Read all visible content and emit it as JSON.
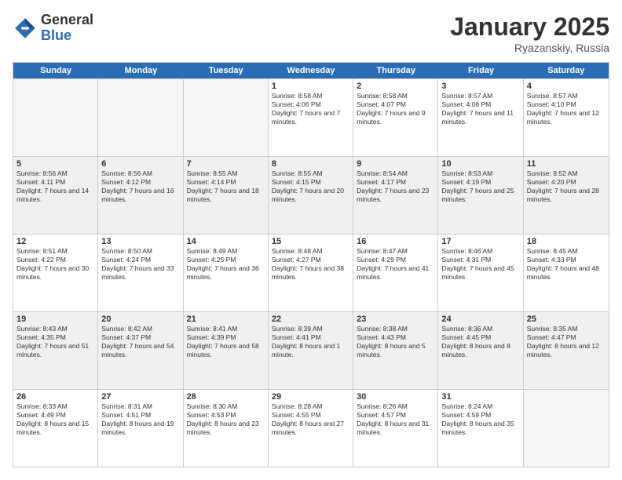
{
  "logo": {
    "general": "General",
    "blue": "Blue"
  },
  "title": "January 2025",
  "location": "Ryazanskiy, Russia",
  "days": [
    "Sunday",
    "Monday",
    "Tuesday",
    "Wednesday",
    "Thursday",
    "Friday",
    "Saturday"
  ],
  "weeks": [
    [
      {
        "day": "",
        "empty": true
      },
      {
        "day": "",
        "empty": true
      },
      {
        "day": "",
        "empty": true
      },
      {
        "day": "1",
        "sunrise": "8:58 AM",
        "sunset": "4:06 PM",
        "daylight": "7 hours and 7 minutes."
      },
      {
        "day": "2",
        "sunrise": "8:58 AM",
        "sunset": "4:07 PM",
        "daylight": "7 hours and 9 minutes."
      },
      {
        "day": "3",
        "sunrise": "8:57 AM",
        "sunset": "4:08 PM",
        "daylight": "7 hours and 11 minutes."
      },
      {
        "day": "4",
        "sunrise": "8:57 AM",
        "sunset": "4:10 PM",
        "daylight": "7 hours and 12 minutes."
      }
    ],
    [
      {
        "day": "5",
        "sunrise": "8:56 AM",
        "sunset": "4:11 PM",
        "daylight": "7 hours and 14 minutes."
      },
      {
        "day": "6",
        "sunrise": "8:56 AM",
        "sunset": "4:12 PM",
        "daylight": "7 hours and 16 minutes."
      },
      {
        "day": "7",
        "sunrise": "8:55 AM",
        "sunset": "4:14 PM",
        "daylight": "7 hours and 18 minutes."
      },
      {
        "day": "8",
        "sunrise": "8:55 AM",
        "sunset": "4:15 PM",
        "daylight": "7 hours and 20 minutes."
      },
      {
        "day": "9",
        "sunrise": "8:54 AM",
        "sunset": "4:17 PM",
        "daylight": "7 hours and 23 minutes."
      },
      {
        "day": "10",
        "sunrise": "8:53 AM",
        "sunset": "4:19 PM",
        "daylight": "7 hours and 25 minutes."
      },
      {
        "day": "11",
        "sunrise": "8:52 AM",
        "sunset": "4:20 PM",
        "daylight": "7 hours and 28 minutes."
      }
    ],
    [
      {
        "day": "12",
        "sunrise": "8:51 AM",
        "sunset": "4:22 PM",
        "daylight": "7 hours and 30 minutes."
      },
      {
        "day": "13",
        "sunrise": "8:50 AM",
        "sunset": "4:24 PM",
        "daylight": "7 hours and 33 minutes."
      },
      {
        "day": "14",
        "sunrise": "8:49 AM",
        "sunset": "4:25 PM",
        "daylight": "7 hours and 36 minutes."
      },
      {
        "day": "15",
        "sunrise": "8:48 AM",
        "sunset": "4:27 PM",
        "daylight": "7 hours and 38 minutes."
      },
      {
        "day": "16",
        "sunrise": "8:47 AM",
        "sunset": "4:29 PM",
        "daylight": "7 hours and 41 minutes."
      },
      {
        "day": "17",
        "sunrise": "8:46 AM",
        "sunset": "4:31 PM",
        "daylight": "7 hours and 45 minutes."
      },
      {
        "day": "18",
        "sunrise": "8:45 AM",
        "sunset": "4:33 PM",
        "daylight": "7 hours and 48 minutes."
      }
    ],
    [
      {
        "day": "19",
        "sunrise": "8:43 AM",
        "sunset": "4:35 PM",
        "daylight": "7 hours and 51 minutes."
      },
      {
        "day": "20",
        "sunrise": "8:42 AM",
        "sunset": "4:37 PM",
        "daylight": "7 hours and 54 minutes."
      },
      {
        "day": "21",
        "sunrise": "8:41 AM",
        "sunset": "4:39 PM",
        "daylight": "7 hours and 58 minutes."
      },
      {
        "day": "22",
        "sunrise": "8:39 AM",
        "sunset": "4:41 PM",
        "daylight": "8 hours and 1 minute."
      },
      {
        "day": "23",
        "sunrise": "8:38 AM",
        "sunset": "4:43 PM",
        "daylight": "8 hours and 5 minutes."
      },
      {
        "day": "24",
        "sunrise": "8:36 AM",
        "sunset": "4:45 PM",
        "daylight": "8 hours and 8 minutes."
      },
      {
        "day": "25",
        "sunrise": "8:35 AM",
        "sunset": "4:47 PM",
        "daylight": "8 hours and 12 minutes."
      }
    ],
    [
      {
        "day": "26",
        "sunrise": "8:33 AM",
        "sunset": "4:49 PM",
        "daylight": "8 hours and 15 minutes."
      },
      {
        "day": "27",
        "sunrise": "8:31 AM",
        "sunset": "4:51 PM",
        "daylight": "8 hours and 19 minutes."
      },
      {
        "day": "28",
        "sunrise": "8:30 AM",
        "sunset": "4:53 PM",
        "daylight": "8 hours and 23 minutes."
      },
      {
        "day": "29",
        "sunrise": "8:28 AM",
        "sunset": "4:55 PM",
        "daylight": "8 hours and 27 minutes."
      },
      {
        "day": "30",
        "sunrise": "8:26 AM",
        "sunset": "4:57 PM",
        "daylight": "8 hours and 31 minutes."
      },
      {
        "day": "31",
        "sunrise": "8:24 AM",
        "sunset": "4:59 PM",
        "daylight": "8 hours and 35 minutes."
      },
      {
        "day": "",
        "empty": true
      }
    ]
  ]
}
